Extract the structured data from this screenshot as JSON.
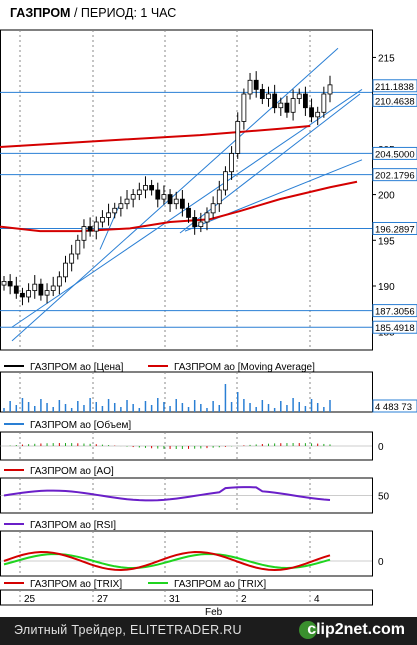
{
  "header": {
    "ticker": "ГАЗПРОМ",
    "separator": "/",
    "period": "ПЕРИОД: 1 ЧАС"
  },
  "price_axis_ticks": [
    "215",
    "210",
    "205",
    "200",
    "195",
    "190",
    "185"
  ],
  "price_tags": [
    "211.1838",
    "210.4638",
    "204.5000",
    "202.1796",
    "196.2897",
    "187.3056",
    "185.4918"
  ],
  "legends": {
    "price": {
      "label1": "ГАЗПРОМ ао [Цена]",
      "label2": "ГАЗПРОМ ао [Moving Average]"
    },
    "volume": {
      "label": "ГАЗПРОМ ао [Объем]",
      "value": "4 483 73"
    },
    "ao": {
      "label": "ГАЗПРОМ ао [AO]",
      "tick": "0"
    },
    "rsi": {
      "label": "ГАЗПРОМ ао [RSI]",
      "tick": "50"
    },
    "trix": {
      "label1": "ГАЗПРОМ ао [TRIX]",
      "label2": "ГАЗПРОМ ао [TRIX]",
      "tick": "0"
    }
  },
  "x_axis": {
    "labels": [
      "25",
      "27",
      "31",
      "2",
      "4"
    ],
    "month": "Feb"
  },
  "colors": {
    "candle_up": "#ffffff",
    "candle_down": "#000000",
    "ma_red": "#d40000",
    "channel_blue": "#2a7fd4",
    "hline": "#2a7fd4",
    "volume": "#2a7fd4",
    "rsi": "#6a1fc8",
    "trix_green": "#1fd41f",
    "ao_green": "#1fa81f"
  },
  "footer": {
    "left": "Элитный Трейдер, ELITETRADER.RU",
    "logo": "clip2net.com"
  },
  "chart_data": {
    "type": "candlestick",
    "title": "ГАЗПРОМ / ПЕРИОД: 1 ЧАС",
    "y_range": [
      183,
      218
    ],
    "close_series_approx": [
      190.5,
      190.0,
      189.2,
      188.8,
      189.5,
      190.2,
      189.0,
      189.5,
      190.0,
      191.0,
      192.5,
      193.5,
      195.0,
      196.5,
      196.0,
      197.0,
      197.5,
      198.0,
      198.5,
      199.0,
      199.5,
      200.0,
      200.5,
      201.0,
      200.5,
      199.5,
      200.0,
      199.0,
      199.5,
      198.5,
      197.5,
      196.5,
      197.0,
      198.0,
      199.0,
      200.5,
      202.5,
      204.5,
      208.0,
      211.0,
      212.5,
      211.5,
      210.5,
      211.0,
      209.5,
      210.0,
      209.0,
      210.5,
      211.0,
      209.5,
      208.5,
      209.0,
      211.0,
      212.0
    ]
  }
}
